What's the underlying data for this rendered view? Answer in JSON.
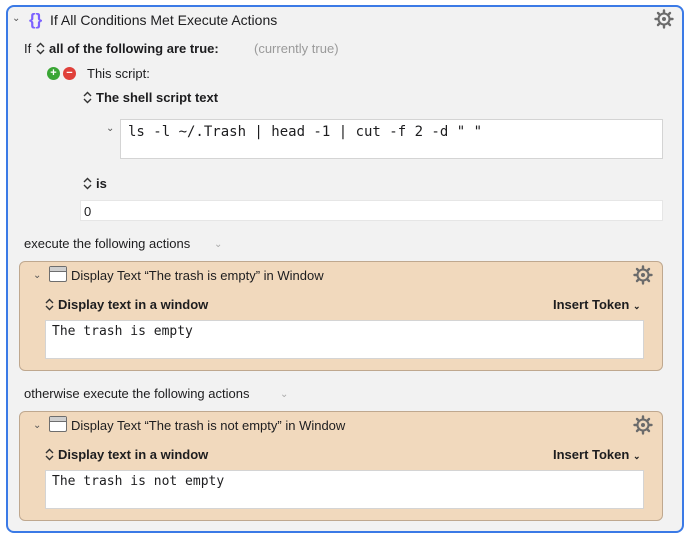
{
  "group": {
    "title": "If All Conditions Met Execute Actions",
    "icon": "curly-braces-icon"
  },
  "condition": {
    "if_label": "If",
    "match_mode": "all of the following are true:",
    "status": "(currently true)",
    "script_label": "This script:",
    "shell_label": "The shell script text",
    "script_text": "ls -l ~/.Trash | head -1 | cut -f 2 -d \" \"",
    "comparator": "is",
    "value": "0"
  },
  "then": {
    "label": "execute the following actions",
    "action_title": "Display Text “The trash is empty” in Window",
    "mode_label": "Display text in a window",
    "insert_token": "Insert Token",
    "text": "The trash is empty"
  },
  "else": {
    "label": "otherwise execute the following actions",
    "action_title": "Display Text “The trash is not empty” in Window",
    "mode_label": "Display text in a window",
    "insert_token": "Insert Token",
    "text": "The trash is not empty"
  },
  "colors": {
    "accent_border": "#3b7ae6",
    "action_bg": "#f1d9bd",
    "add_green": "#3aa635",
    "remove_red": "#e0403a",
    "braces_purple": "#7b61ff"
  }
}
